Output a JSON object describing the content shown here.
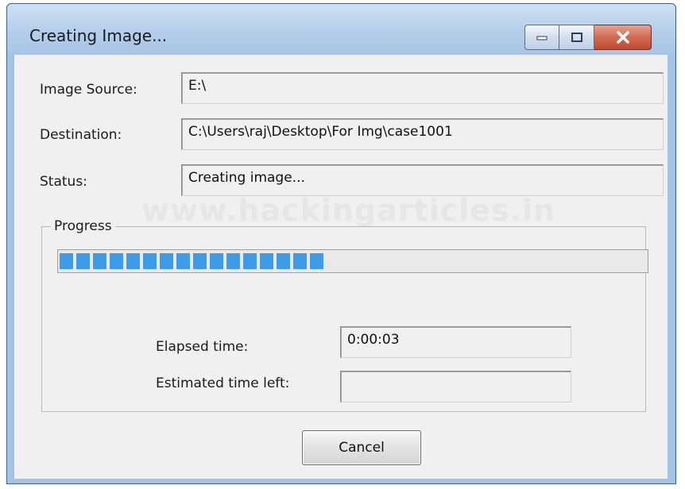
{
  "window": {
    "title": "Creating Image...",
    "controls": {
      "minimize_icon": "minimize-icon",
      "maximize_icon": "maximize-icon",
      "close_icon": "close-icon"
    }
  },
  "form": {
    "image_source": {
      "label": "Image Source:",
      "value": "E:\\"
    },
    "destination": {
      "label": "Destination:",
      "value": "C:\\Users\\raj\\Desktop\\For Img\\case1001"
    },
    "status": {
      "label": "Status:",
      "value": "Creating image..."
    }
  },
  "watermark": "www.hackingarticles.in",
  "progress": {
    "legend": "Progress",
    "fraction": 0.45,
    "elapsed": {
      "label": "Elapsed time:",
      "value": "0:00:03"
    },
    "estimated": {
      "label": "Estimated time left:",
      "value": ""
    }
  },
  "buttons": {
    "cancel": "Cancel"
  },
  "colors": {
    "progress_fill": "#3d9be8",
    "close_button": "#c9573e",
    "titlebar": "#b6cfec"
  }
}
